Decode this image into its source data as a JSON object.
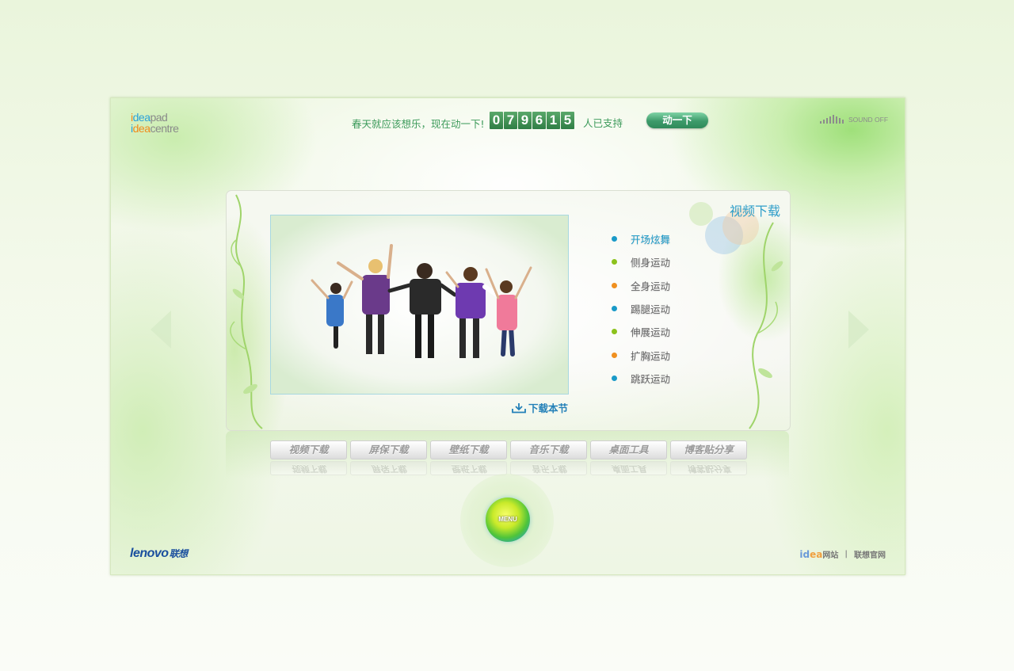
{
  "header": {
    "logo_line1": [
      "i",
      "dea",
      "pad"
    ],
    "logo_line2": [
      "i",
      "dea",
      "centre"
    ],
    "slogan": "春天就应该想乐，现在动一下!",
    "counter_digits": [
      "0",
      "7",
      "9",
      "6",
      "1",
      "5"
    ],
    "support_text": "人已支持",
    "move_button": "动一下",
    "sound_label": "SOUND OFF"
  },
  "panel": {
    "title": "视频下载",
    "download_link": "下载本节",
    "exercises": [
      {
        "label": "开场炫舞",
        "color": "#1a9ac8",
        "active": true
      },
      {
        "label": "侧身运动",
        "color": "#8cc21c",
        "active": false
      },
      {
        "label": "全身运动",
        "color": "#f09020",
        "active": false
      },
      {
        "label": "踢腿运动",
        "color": "#1a9ac8",
        "active": false
      },
      {
        "label": "伸展运动",
        "color": "#8cc21c",
        "active": false
      },
      {
        "label": "扩胸运动",
        "color": "#f09020",
        "active": false
      },
      {
        "label": "跳跃运动",
        "color": "#1a9ac8",
        "active": false
      }
    ]
  },
  "tabs": [
    "视频下载",
    "屏保下载",
    "壁纸下载",
    "音乐下载",
    "桌面工具",
    "博客贴分享"
  ],
  "menu_label": "MENU",
  "footer": {
    "lenovo": "lenovo",
    "lenovo_cn": "联想",
    "idea_site_prefix": [
      "id",
      "ea"
    ],
    "idea_site": "网站",
    "separator": "|",
    "official_site": "联想官网"
  },
  "colors": {
    "accent_green": "#3c9a5a",
    "accent_blue": "#2f9ec9"
  }
}
